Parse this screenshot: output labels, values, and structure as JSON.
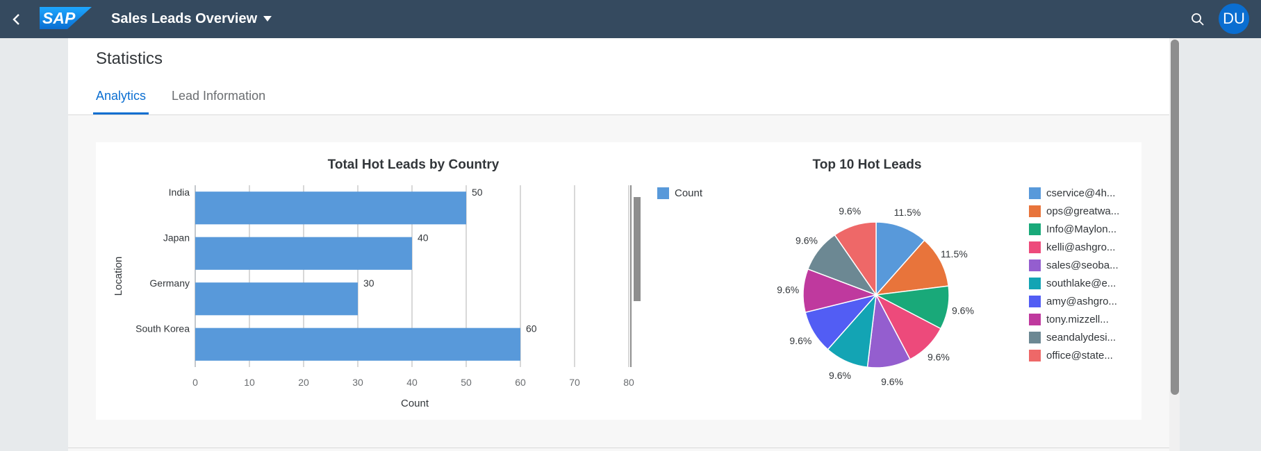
{
  "shell": {
    "logo_text": "SAP",
    "app_title": "Sales Leads Overview",
    "avatar_initials": "DU"
  },
  "page": {
    "title": "Statistics",
    "tabs": [
      {
        "label": "Analytics",
        "active": true
      },
      {
        "label": "Lead Information",
        "active": false
      }
    ]
  },
  "colors": {
    "shell_bg": "#354a5f",
    "accent": "#0a6ed1",
    "bar": "#5899da"
  },
  "chart_data": [
    {
      "type": "bar",
      "orientation": "horizontal",
      "title": "Total Hot Leads by Country",
      "xlabel": "Count",
      "ylabel": "Location",
      "categories": [
        "India",
        "Japan",
        "Germany",
        "South Korea"
      ],
      "series": [
        {
          "name": "Count",
          "values": [
            50,
            40,
            30,
            60
          ],
          "color": "#5899da"
        }
      ],
      "xlim": [
        0,
        80
      ],
      "xticks": [
        "0",
        "10",
        "20",
        "30",
        "40",
        "50",
        "60",
        "70",
        "80"
      ],
      "data_labels": [
        "50",
        "40",
        "30",
        "60"
      ],
      "grid": true,
      "legend": "right"
    },
    {
      "type": "pie",
      "title": "Top 10 Hot Leads",
      "slices": [
        {
          "label": "cservice@4h...",
          "value": 11.5,
          "display": "11.5%",
          "color": "#5899da"
        },
        {
          "label": "ops@greatwa...",
          "value": 11.5,
          "display": "11.5%",
          "color": "#e8743b"
        },
        {
          "label": "Info@Maylon...",
          "value": 9.6,
          "display": "9.6%",
          "color": "#19a979"
        },
        {
          "label": "kelli@ashgro...",
          "value": 9.6,
          "display": "9.6%",
          "color": "#ed4a7b"
        },
        {
          "label": "sales@seoba...",
          "value": 9.6,
          "display": "9.6%",
          "color": "#945ecf"
        },
        {
          "label": "southlake@e...",
          "value": 9.6,
          "display": "9.6%",
          "color": "#13a4b4"
        },
        {
          "label": "amy@ashgro...",
          "value": 9.6,
          "display": "9.6%",
          "color": "#525df4"
        },
        {
          "label": "tony.mizzell...",
          "value": 9.6,
          "display": "9.6%",
          "color": "#bf399e"
        },
        {
          "label": "seandalydesi...",
          "value": 9.6,
          "display": "9.6%",
          "color": "#6c8893"
        },
        {
          "label": "office@state...",
          "value": 9.6,
          "display": "9.6%",
          "color": "#ee6868"
        }
      ],
      "legend": "right"
    }
  ]
}
